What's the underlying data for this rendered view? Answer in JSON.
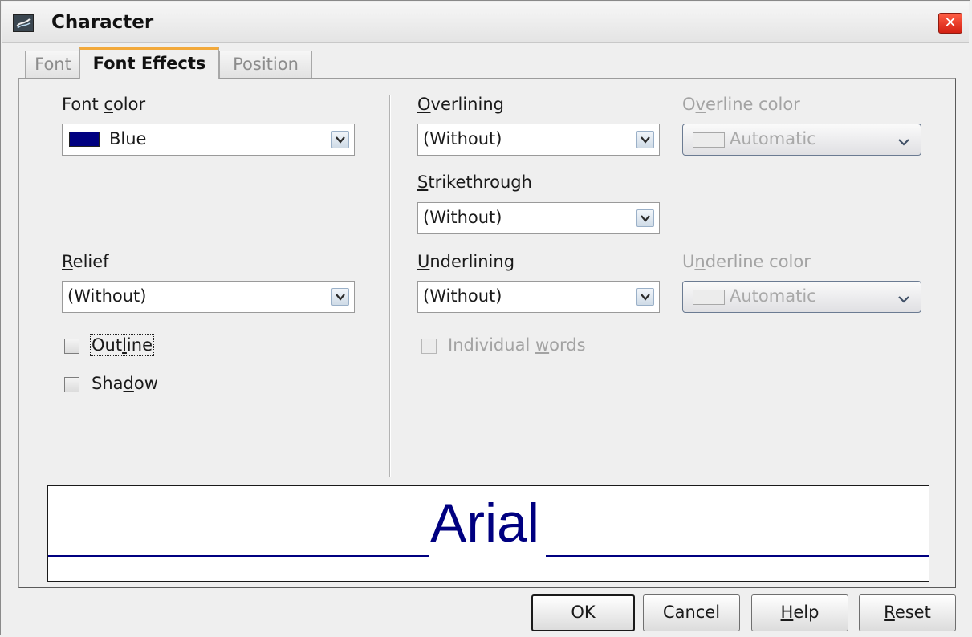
{
  "window": {
    "title": "Character"
  },
  "tabs": [
    {
      "label": "Font"
    },
    {
      "label": "Font Effects"
    },
    {
      "label": "Position"
    }
  ],
  "font_color": {
    "label_pre": "Font ",
    "label_key": "c",
    "label_post": "olor",
    "value": "Blue",
    "swatch_color": "#000080"
  },
  "relief": {
    "label_key": "R",
    "label_post": "elief",
    "value": "(Without)"
  },
  "outline": {
    "label_pre": "Out",
    "label_key": "l",
    "label_post": "ine",
    "checked": false
  },
  "shadow": {
    "label_pre": "Sha",
    "label_key": "d",
    "label_post": "ow",
    "checked": false
  },
  "overlining": {
    "label_key": "O",
    "label_post": "verlining",
    "value": "(Without)"
  },
  "overline_color": {
    "label_pre": "O",
    "label_key": "v",
    "label_post": "erline color",
    "value": "Automatic"
  },
  "strikethrough": {
    "label_key": "S",
    "label_post": "trikethrough",
    "value": "(Without)"
  },
  "underlining": {
    "label_key": "U",
    "label_post": "nderlining",
    "value": "(Without)"
  },
  "underline_color": {
    "label_pre": "U",
    "label_key": "n",
    "label_post": "derline color",
    "value": "Automatic"
  },
  "individual_words": {
    "label_pre": "Individual ",
    "label_key": "w",
    "label_post": "ords",
    "checked": false
  },
  "preview": {
    "sample": "Arial",
    "color": "#000080"
  },
  "buttons": {
    "ok": "OK",
    "cancel": "Cancel",
    "help_key": "H",
    "help_post": "elp",
    "reset_key": "R",
    "reset_post": "eset"
  }
}
